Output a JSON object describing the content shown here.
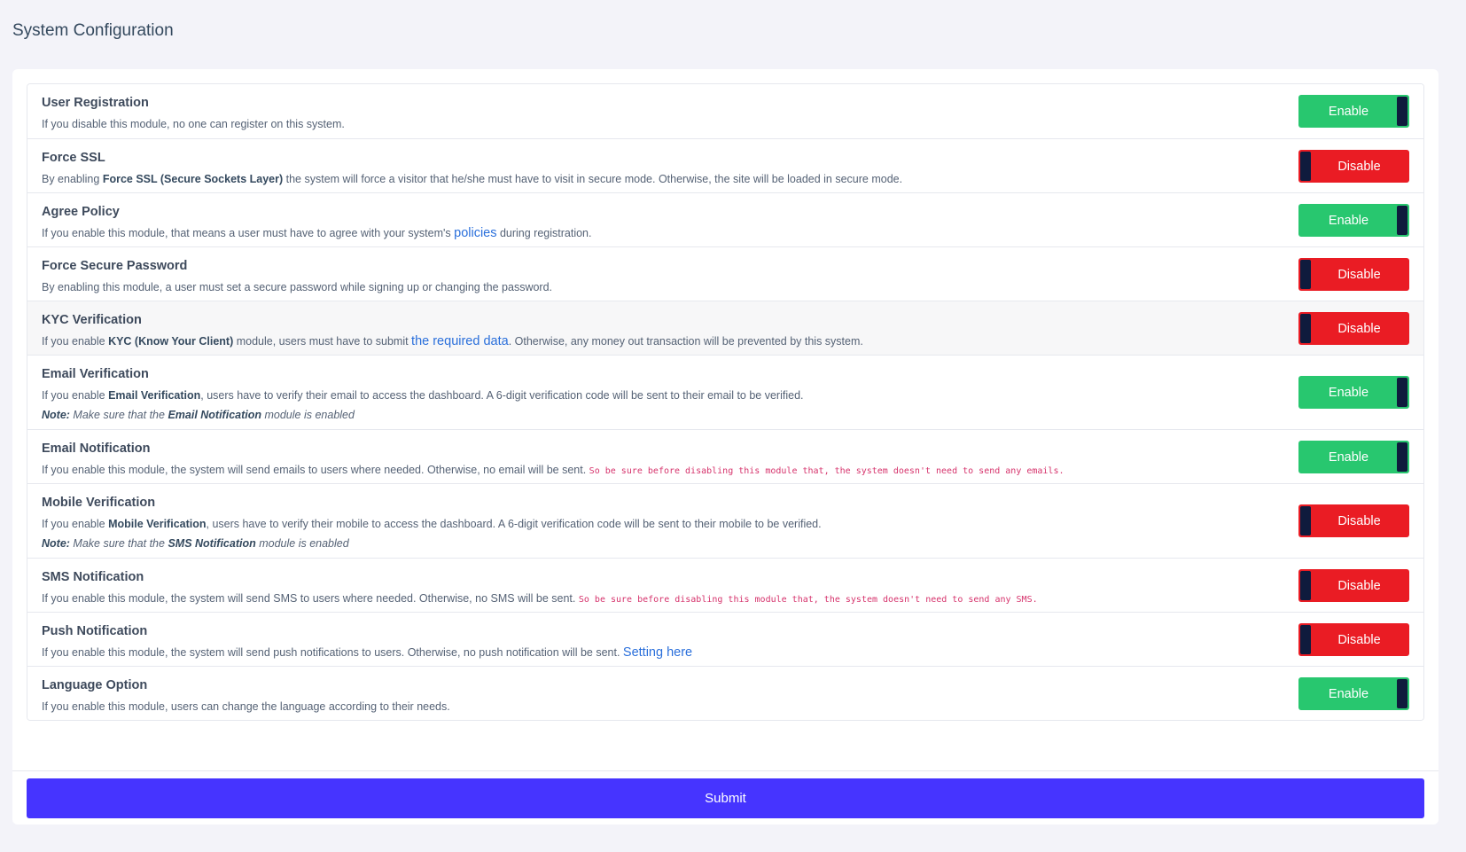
{
  "page": {
    "title": "System Configuration"
  },
  "colors": {
    "enable": "#28c76f",
    "disable": "#ea1c24",
    "submit": "#4634ff",
    "link": "#2a6fdb",
    "code": "#d6336c"
  },
  "settings": [
    {
      "title": "User Registration",
      "desc": [
        "If you disable this module, no one can register on this system."
      ],
      "state": "Enable"
    },
    {
      "title": "Force SSL",
      "desc": [
        "By enabling ",
        "Force SSL (Secure Sockets Layer)",
        " the system will force a visitor that he/she must have to visit in secure mode. Otherwise, the site will be loaded in secure mode."
      ],
      "state": "Disable"
    },
    {
      "title": "Agree Policy",
      "desc": [
        "If you enable this module, that means a user must have to agree with your system's ",
        "policies",
        " during registration."
      ],
      "state": "Enable"
    },
    {
      "title": "Force Secure Password",
      "desc": [
        "By enabling this module, a user must set a secure password while signing up or changing the password."
      ],
      "state": "Disable"
    },
    {
      "title": "KYC Verification",
      "desc": [
        "If you enable ",
        "KYC (Know Your Client)",
        " module, users must have to submit ",
        "the required data",
        ". Otherwise, any money out transaction will be prevented by this system."
      ],
      "state": "Disable"
    },
    {
      "title": "Email Verification",
      "desc": [
        "If you enable ",
        "Email Verification",
        ", users have to verify their email to access the dashboard. A 6-digit verification code will be sent to their email to be verified."
      ],
      "note": [
        "Note:",
        " Make sure that the ",
        "Email Notification",
        " module is enabled"
      ],
      "state": "Enable"
    },
    {
      "title": "Email Notification",
      "desc": [
        "If you enable this module, the system will send emails to users where needed. Otherwise, no email will be sent. ",
        "So be sure before disabling this module that, the system doesn't need to send any emails."
      ],
      "state": "Enable"
    },
    {
      "title": "Mobile Verification",
      "desc": [
        "If you enable ",
        "Mobile Verification",
        ", users have to verify their mobile to access the dashboard. A 6-digit verification code will be sent to their mobile to be verified."
      ],
      "note": [
        "Note:",
        " Make sure that the ",
        "SMS Notification",
        " module is enabled"
      ],
      "state": "Disable"
    },
    {
      "title": "SMS Notification",
      "desc": [
        "If you enable this module, the system will send SMS to users where needed. Otherwise, no SMS will be sent. ",
        "So be sure before disabling this module that, the system doesn't need to send any SMS."
      ],
      "state": "Disable"
    },
    {
      "title": "Push Notification",
      "desc": [
        "If you enable this module, the system will send push notifications to users. Otherwise, no push notification will be sent. ",
        "Setting here"
      ],
      "state": "Disable"
    },
    {
      "title": "Language Option",
      "desc": [
        "If you enable this module, users can change the language according to their needs."
      ],
      "state": "Enable"
    }
  ],
  "submit_label": "Submit"
}
